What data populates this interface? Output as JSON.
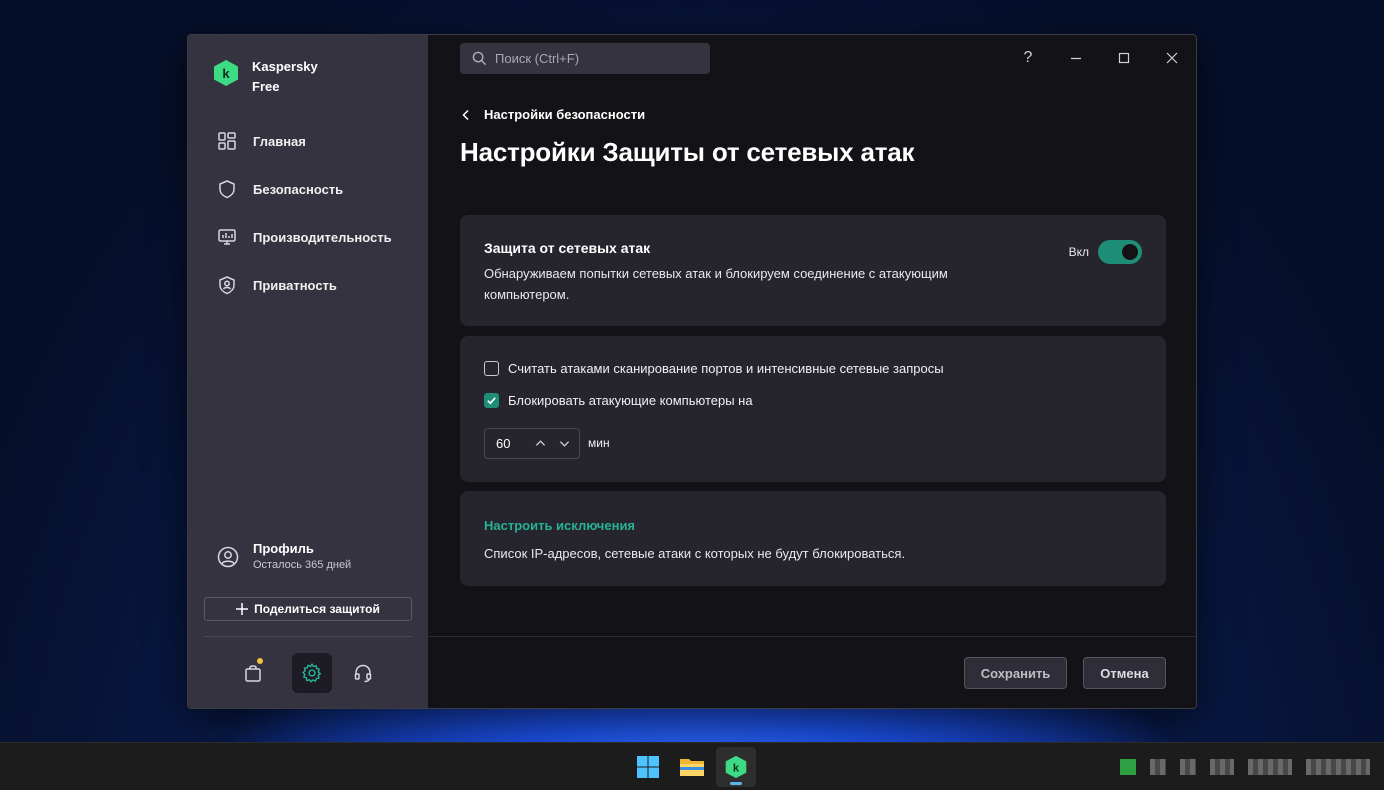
{
  "app": {
    "brand_line1": "Kaspersky",
    "brand_line2": "Free"
  },
  "sidebar": {
    "items": [
      {
        "label": "Главная",
        "icon": "home-grid-icon"
      },
      {
        "label": "Безопасность",
        "icon": "shield-icon"
      },
      {
        "label": "Производительность",
        "icon": "monitor-icon"
      },
      {
        "label": "Приватность",
        "icon": "privacy-shield-icon"
      }
    ],
    "profile": {
      "name": "Профиль",
      "sub": "Осталось 365 дней"
    },
    "share_label": "Поделиться защитой",
    "bottom_icons": [
      "shop-bag-icon",
      "settings-gear-icon",
      "support-headset-icon"
    ]
  },
  "search": {
    "placeholder": "Поиск (Ctrl+F)"
  },
  "window_controls": {
    "help": "?"
  },
  "breadcrumb": "Настройки безопасности",
  "page_title": "Настройки Защиты от сетевых атак",
  "card1": {
    "title": "Защита от сетевых атак",
    "desc": "Обнаруживаем попытки сетевых атак и блокируем соединение с атакующим компьютером.",
    "toggle_label": "Вкл",
    "toggle_on": true
  },
  "card2": {
    "option1": {
      "label": "Считать атаками сканирование портов и интенсивные сетевые запросы",
      "checked": false
    },
    "option2": {
      "label": "Блокировать атакующие компьютеры на",
      "checked": true
    },
    "block_value": "60",
    "block_unit": "мин"
  },
  "card3": {
    "link": "Настроить исключения",
    "desc": "Список IP-адресов, сетевые атаки с которых не будут блокироваться."
  },
  "footer": {
    "save": "Сохранить",
    "cancel": "Отмена"
  },
  "colors": {
    "accent": "#1e8e76",
    "link": "#26b294",
    "sidebar": "#34333f",
    "main": "#131317",
    "card": "#26252e"
  }
}
